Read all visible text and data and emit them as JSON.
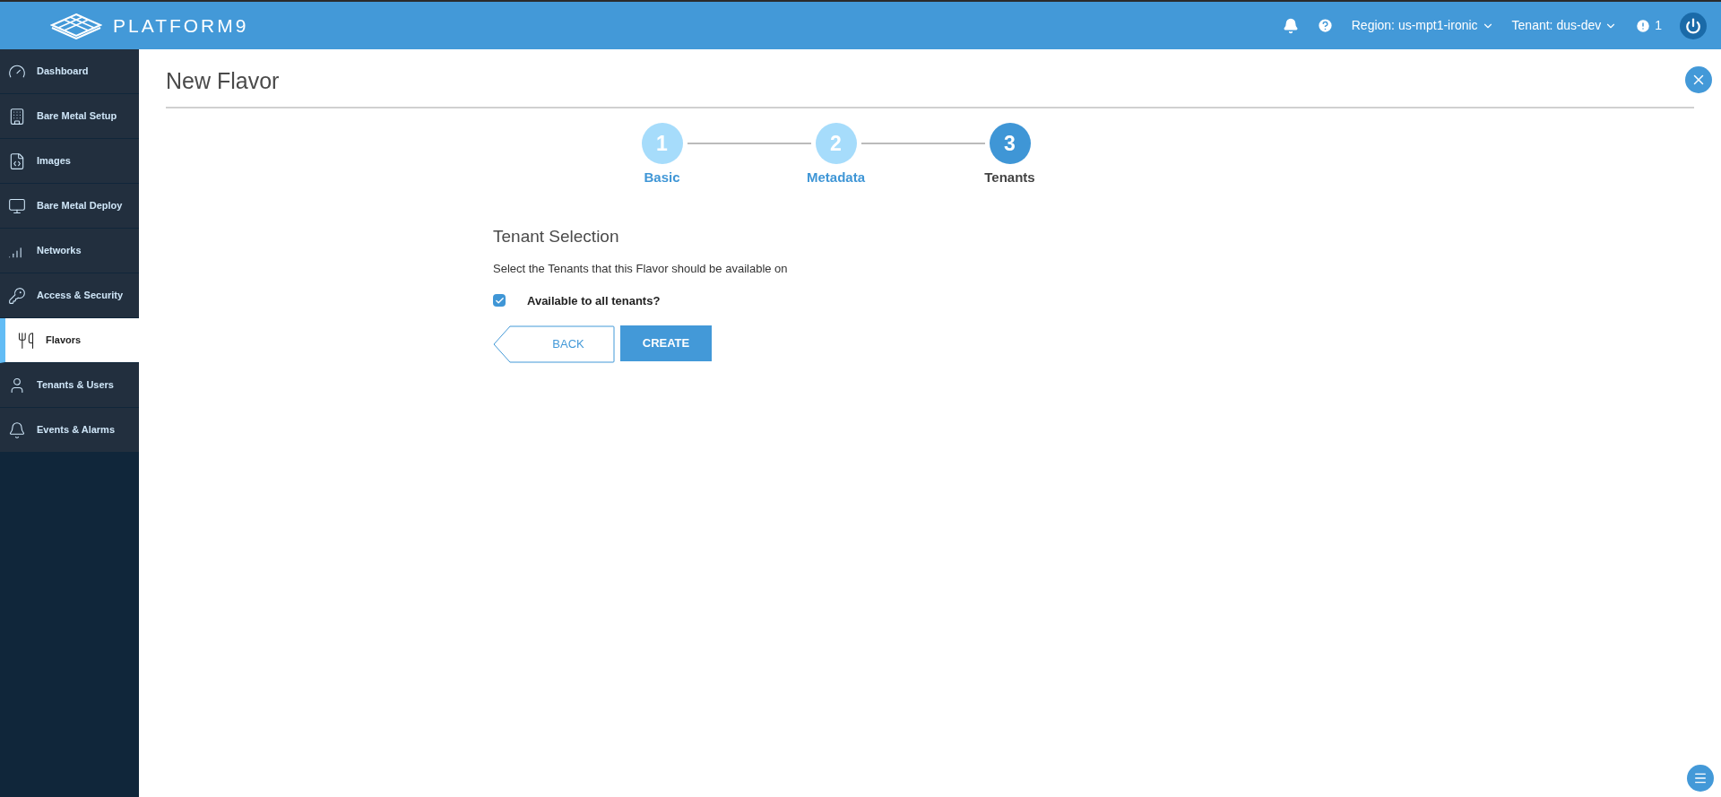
{
  "header": {
    "logo": "PLATFORM9",
    "region": "Region: us-mpt1-ironic",
    "tenant": "Tenant: dus-dev",
    "alerts": "1"
  },
  "sidebar": {
    "items": [
      {
        "label": "Dashboard",
        "selected": false
      },
      {
        "label": "Bare Metal Setup",
        "selected": false
      },
      {
        "label": "Images",
        "selected": false
      },
      {
        "label": "Bare Metal Deploy",
        "selected": false
      },
      {
        "label": "Networks",
        "selected": false
      },
      {
        "label": "Access & Security",
        "selected": false
      },
      {
        "label": "Flavors",
        "selected": true
      },
      {
        "label": "Tenants & Users",
        "selected": false
      },
      {
        "label": "Events & Alarms",
        "selected": false
      }
    ]
  },
  "page": {
    "title": "New Flavor"
  },
  "steps": [
    {
      "number": "1",
      "label": "Basic",
      "selected": false
    },
    {
      "number": "2",
      "label": "Metadata",
      "selected": false
    },
    {
      "number": "3",
      "label": "Tenants",
      "selected": true
    }
  ],
  "form": {
    "heading": "Tenant Selection",
    "description": "Select the Tenants that this Flavor should be available on",
    "checkbox": {
      "label": "Available to all tenants?",
      "checked": true
    },
    "back": "BACK",
    "create": "CREATE"
  }
}
